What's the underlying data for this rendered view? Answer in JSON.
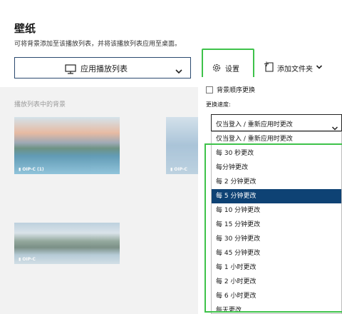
{
  "page": {
    "title": "壁纸",
    "subtitle": "可将背景添加至该播放列表，并将该播放列表应用至桌面。"
  },
  "toolbar": {
    "playlist_label": "应用播放列表",
    "settings_label": "设置",
    "add_folder_label": "添加文件夹"
  },
  "playlist": {
    "section_label": "播放列表中的背景",
    "items": [
      {
        "caption": "OIP-C (1)"
      },
      {
        "caption": "OIP-C"
      },
      {
        "caption": "OIP-C"
      }
    ]
  },
  "settings": {
    "shuffle_label": "背景顺序更换",
    "shuffle_checked": false,
    "speed_label": "更换速度:",
    "speed_value": "仅当登入 / 重新应用时更改",
    "options": [
      "仅当登入 / 重新应用时更改",
      "每 30 秒更改",
      "每分钟更改",
      "每 2 分钟更改",
      "每 5 分钟更改",
      "每 10 分钟更改",
      "每 15 分钟更改",
      "每 30 分钟更改",
      "每 45 分钟更改",
      "每 1 小时更改",
      "每 2 小时更改",
      "每 6 小时更改",
      "每天更改"
    ],
    "selected_option": "每 5 分钟更改"
  },
  "colors": {
    "accent_dark_blue": "#0e4274",
    "highlight_green": "#3ec24a",
    "button_border": "#2b4a6f"
  },
  "icons": {
    "monitor": "monitor-icon",
    "gear": "gear-icon",
    "add_folder": "add-folder-icon",
    "chevron": "chevron-down-icon",
    "pin": "pin-icon"
  }
}
